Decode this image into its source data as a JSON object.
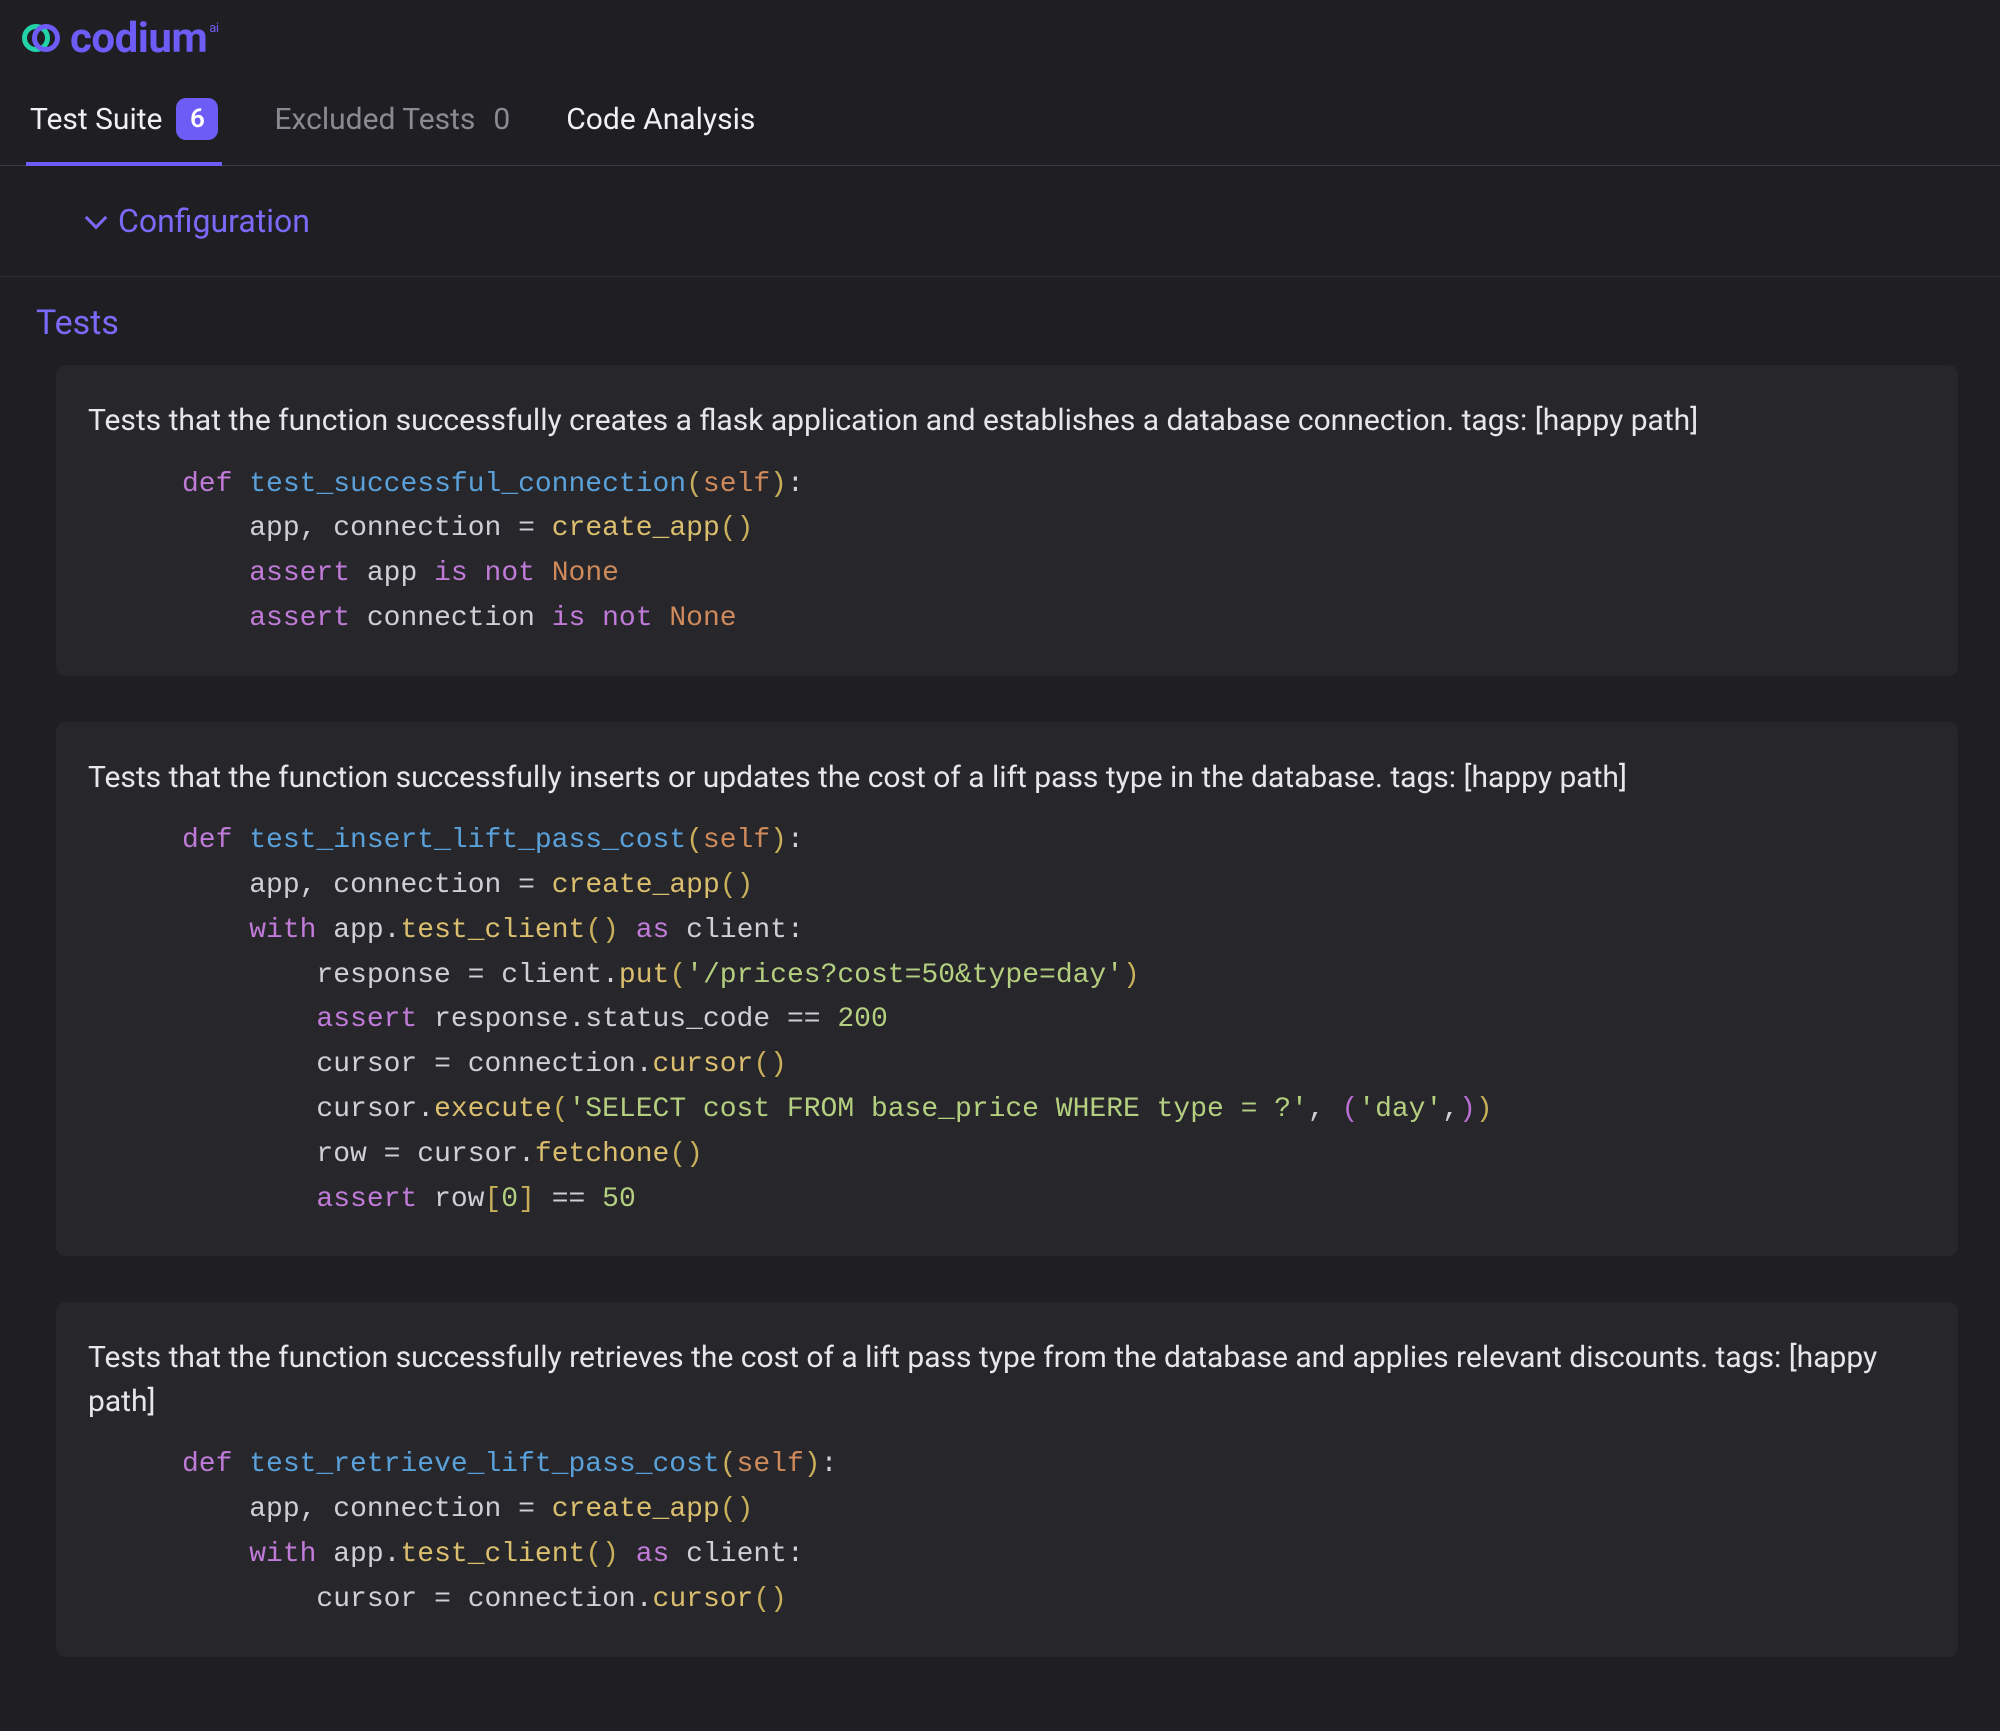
{
  "logo": {
    "word": "codium",
    "sup": "ai"
  },
  "tabs": [
    {
      "label": "Test Suite",
      "badge": "6",
      "active": true
    },
    {
      "label": "Excluded Tests",
      "count": "0",
      "dim": true
    },
    {
      "label": "Code Analysis"
    }
  ],
  "sections": {
    "configuration_label": "Configuration",
    "tests_label": "Tests"
  },
  "tests": [
    {
      "description": "Tests that the function successfully creates a flask application and establishes a database connection. tags: [happy path]",
      "code_html": "<span class=\"tk-kw\">def</span> <span class=\"tk-fn\">test_successful_connection</span><span class=\"tk-br\">(</span><span class=\"tk-self\">self</span><span class=\"tk-br\">)</span><span class=\"tk-pun\">:</span>\n    <span class=\"tk-id\">app</span><span class=\"tk-pun\">,</span> <span class=\"tk-id\">connection</span> <span class=\"tk-op\">=</span> <span class=\"tk-call\">create_app</span><span class=\"tk-br\">()</span>\n    <span class=\"tk-asrt\">assert</span> <span class=\"tk-id\">app</span> <span class=\"tk-kw\">is</span> <span class=\"tk-kw\">not</span> <span class=\"tk-none\">None</span>\n    <span class=\"tk-asrt\">assert</span> <span class=\"tk-id\">connection</span> <span class=\"tk-kw\">is</span> <span class=\"tk-kw\">not</span> <span class=\"tk-none\">None</span>"
    },
    {
      "description": "Tests that the function successfully inserts or updates the cost of a lift pass type in the database. tags: [happy path]",
      "code_html": "<span class=\"tk-kw\">def</span> <span class=\"tk-fn\">test_insert_lift_pass_cost</span><span class=\"tk-br\">(</span><span class=\"tk-self\">self</span><span class=\"tk-br\">)</span><span class=\"tk-pun\">:</span>\n    <span class=\"tk-id\">app</span><span class=\"tk-pun\">,</span> <span class=\"tk-id\">connection</span> <span class=\"tk-op\">=</span> <span class=\"tk-call\">create_app</span><span class=\"tk-br\">()</span>\n    <span class=\"tk-kw\">with</span> <span class=\"tk-id\">app</span><span class=\"tk-pun\">.</span><span class=\"tk-call\">test_client</span><span class=\"tk-br\">()</span> <span class=\"tk-kw\">as</span> <span class=\"tk-id\">client</span><span class=\"tk-pun\">:</span>\n        <span class=\"tk-id\">response</span> <span class=\"tk-op\">=</span> <span class=\"tk-id\">client</span><span class=\"tk-pun\">.</span><span class=\"tk-call\">put</span><span class=\"tk-br\">(</span><span class=\"tk-str\">'/prices?cost=50&amp;type=day'</span><span class=\"tk-br\">)</span>\n        <span class=\"tk-asrt\">assert</span> <span class=\"tk-id\">response</span><span class=\"tk-pun\">.</span><span class=\"tk-id\">status_code</span> <span class=\"tk-op\">==</span> <span class=\"tk-num\">200</span>\n        <span class=\"tk-id\">cursor</span> <span class=\"tk-op\">=</span> <span class=\"tk-id\">connection</span><span class=\"tk-pun\">.</span><span class=\"tk-call\">cursor</span><span class=\"tk-br\">()</span>\n        <span class=\"tk-id\">cursor</span><span class=\"tk-pun\">.</span><span class=\"tk-call\">execute</span><span class=\"tk-br\">(</span><span class=\"tk-str\">'SELECT cost FROM base_price WHERE type = ?'</span><span class=\"tk-pun\">,</span> <span class=\"tk-br2\">(</span><span class=\"tk-str\">'day'</span><span class=\"tk-pun\">,</span><span class=\"tk-br2\">)</span><span class=\"tk-br\">)</span>\n        <span class=\"tk-id\">row</span> <span class=\"tk-op\">=</span> <span class=\"tk-id\">cursor</span><span class=\"tk-pun\">.</span><span class=\"tk-call\">fetchone</span><span class=\"tk-br\">()</span>\n        <span class=\"tk-asrt\">assert</span> <span class=\"tk-id\">row</span><span class=\"tk-br\">[</span><span class=\"tk-num\">0</span><span class=\"tk-br\">]</span> <span class=\"tk-op\">==</span> <span class=\"tk-num\">50</span>"
    },
    {
      "description": "Tests that the function successfully retrieves the cost of a lift pass type from the database and applies relevant discounts. tags: [happy path]",
      "code_html": "<span class=\"tk-kw\">def</span> <span class=\"tk-fn\">test_retrieve_lift_pass_cost</span><span class=\"tk-br\">(</span><span class=\"tk-self\">self</span><span class=\"tk-br\">)</span><span class=\"tk-pun\">:</span>\n    <span class=\"tk-id\">app</span><span class=\"tk-pun\">,</span> <span class=\"tk-id\">connection</span> <span class=\"tk-op\">=</span> <span class=\"tk-call\">create_app</span><span class=\"tk-br\">()</span>\n    <span class=\"tk-kw\">with</span> <span class=\"tk-id\">app</span><span class=\"tk-pun\">.</span><span class=\"tk-call\">test_client</span><span class=\"tk-br\">()</span> <span class=\"tk-kw\">as</span> <span class=\"tk-id\">client</span><span class=\"tk-pun\">:</span>\n        <span class=\"tk-id\">cursor</span> <span class=\"tk-op\">=</span> <span class=\"tk-id\">connection</span><span class=\"tk-pun\">.</span><span class=\"tk-call\">cursor</span><span class=\"tk-br\">()</span>"
    }
  ]
}
